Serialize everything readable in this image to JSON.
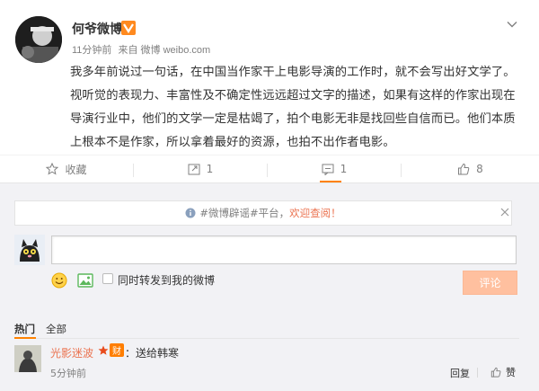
{
  "post": {
    "author": "何爷微博",
    "time": "11分钟前",
    "source_prefix": "来自",
    "source": "微博 weibo.com",
    "content": "我多年前说过一句话，在中国当作家干上电影导演的工作时，就不会写出好文学了。视听觉的表现力、丰富性及不确定性远远超过文字的描述，如果有这样的作家出现在导演行业中，他们的文学一定是枯竭了，拍个电影无非是找回些自信而已。他们本质上根本不是作家，所以拿着最好的资源，也拍不出作者电影。"
  },
  "actions": {
    "favorite_label": "收藏",
    "repost_count": "1",
    "comment_count": "1",
    "like_count": "8"
  },
  "notice": {
    "hashtag": "#微博辟谣#平台",
    "comma": "，",
    "link": "欢迎查阅！"
  },
  "composer": {
    "repost_label": "同时转发到我的微博",
    "submit_label": "评论"
  },
  "sort_tabs": [
    "热门",
    "全部"
  ],
  "comments": [
    {
      "name": "光影迷波",
      "badge": "财",
      "text": "：送给韩寒",
      "time": "5分钟前",
      "report": "回复",
      "like": "赞"
    }
  ],
  "colors": {
    "accent": "#eb7350",
    "submit_bg": "#ffc09f",
    "area_bg": "#f2f2f5"
  }
}
